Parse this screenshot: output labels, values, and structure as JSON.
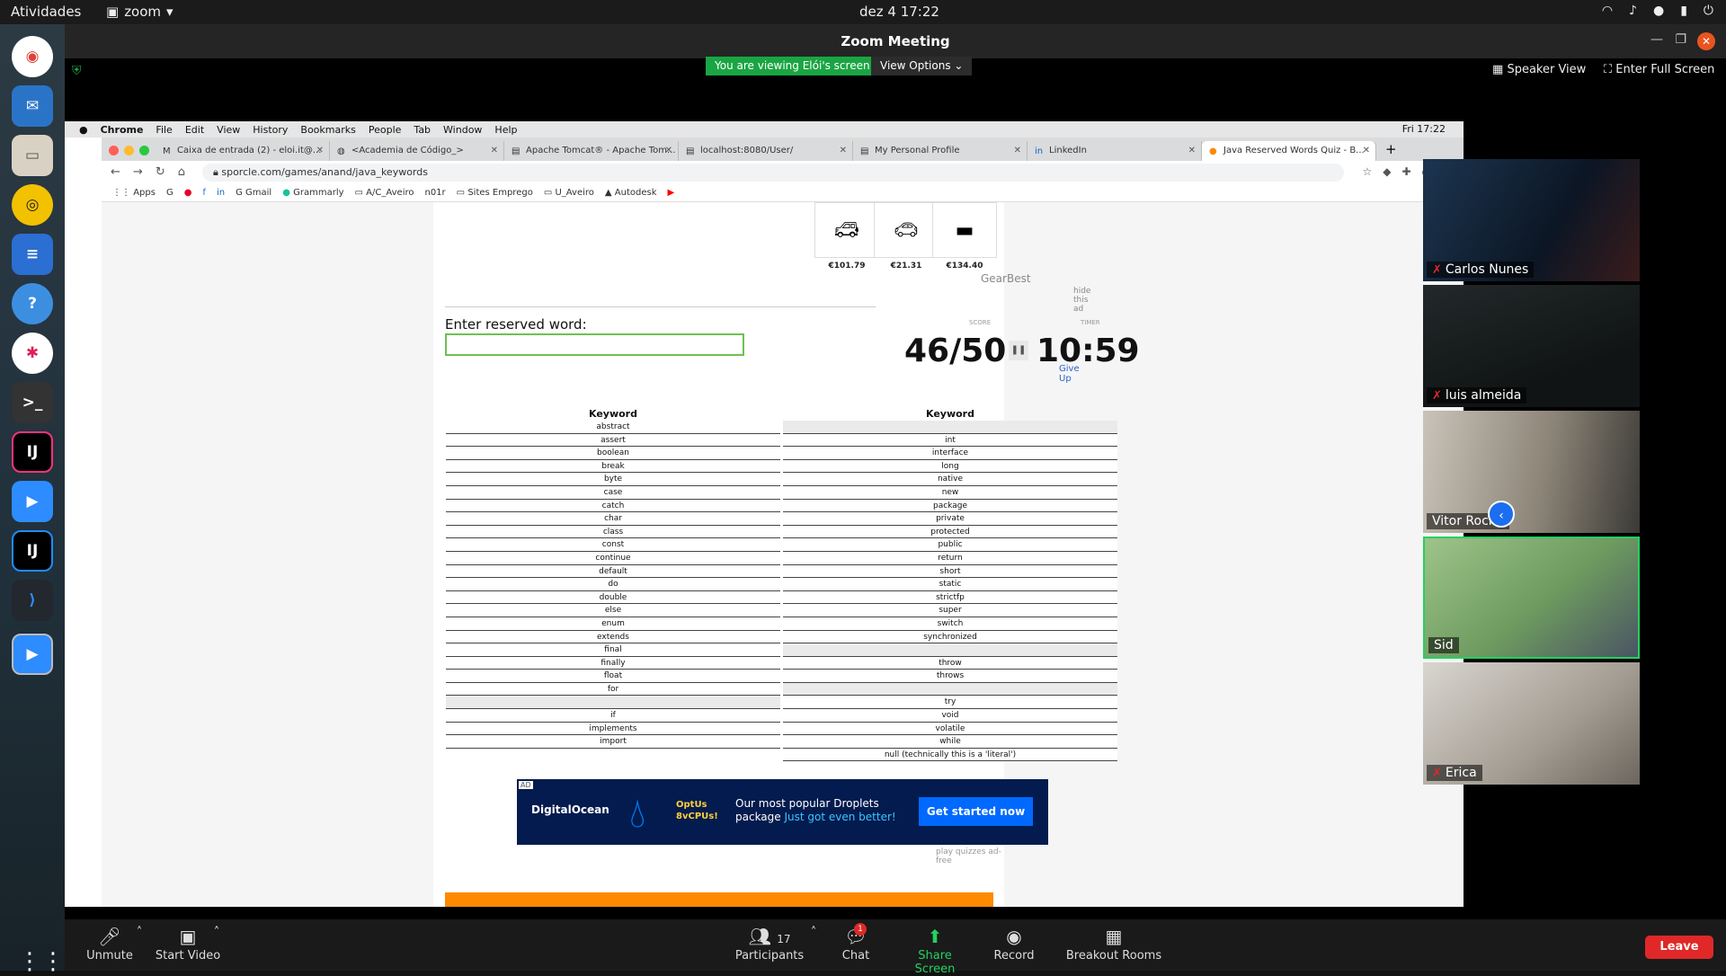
{
  "system": {
    "activities": "Atividades",
    "app_name": "zoom",
    "clock": "dez 4  17:22"
  },
  "zoom": {
    "title": "Zoom Meeting",
    "viewing_banner": "You are viewing Elói's screen",
    "view_options": "View Options",
    "speaker_view": "Speaker View",
    "enter_full_screen": "Enter Full Screen",
    "participants": [
      {
        "name": "Carlos Nunes",
        "muted": true
      },
      {
        "name": "luis almeida",
        "muted": true
      },
      {
        "name": "Vitor Rocha",
        "muted": false
      },
      {
        "name": "Sid",
        "muted": false
      },
      {
        "name": "Erica",
        "muted": true
      }
    ],
    "toolbar": {
      "unmute": "Unmute",
      "start_video": "Start Video",
      "participants_count": "17",
      "participants": "Participants",
      "chat": "Chat",
      "chat_badge": "1",
      "share_screen": "Share Screen",
      "record": "Record",
      "breakout_rooms": "Breakout Rooms",
      "leave": "Leave"
    }
  },
  "mac": {
    "menu": [
      "Chrome",
      "File",
      "Edit",
      "View",
      "History",
      "Bookmarks",
      "People",
      "Tab",
      "Window",
      "Help"
    ],
    "time": "Fri 17:22"
  },
  "chrome": {
    "tabs": [
      {
        "label": "Caixa de entrada (2) - eloi.it@..."
      },
      {
        "label": "<Academia de Código_>"
      },
      {
        "label": "Apache Tomcat® - Apache Tom..."
      },
      {
        "label": "localhost:8080/User/"
      },
      {
        "label": "My Personal Profile"
      },
      {
        "label": "LinkedIn"
      },
      {
        "label": "Java Reserved Words Quiz - B..."
      }
    ],
    "url": "sporcle.com/games/anand/java_keywords",
    "bookmarks": [
      "Apps",
      "Gmail",
      "Grammarly",
      "A/C_Aveiro",
      "n01r",
      "Sites Emprego",
      "U_Aveiro",
      "Autodesk"
    ]
  },
  "quiz": {
    "ad_prices": [
      "€101.79",
      "€21.31",
      "€134.40"
    ],
    "ad_brand": "GearBest",
    "hide_ad": "hide this ad",
    "enter_label": "Enter reserved word:",
    "score_label": "SCORE",
    "timer_label": "TIMER",
    "score": "46/50",
    "timer": "10:59",
    "give_up": "Give Up",
    "column_header": "Keyword",
    "left_keywords": [
      "abstract",
      "assert",
      "boolean",
      "break",
      "byte",
      "case",
      "catch",
      "char",
      "class",
      "const",
      "continue",
      "default",
      "do",
      "double",
      "else",
      "enum",
      "extends",
      "final",
      "finally",
      "float",
      "for",
      "",
      "if",
      "implements",
      "import"
    ],
    "right_keywords": [
      "",
      "int",
      "interface",
      "long",
      "native",
      "new",
      "package",
      "private",
      "protected",
      "public",
      "return",
      "short",
      "static",
      "strictfp",
      "super",
      "switch",
      "synchronized",
      "",
      "throw",
      "throws",
      "",
      "try",
      "void",
      "volatile",
      "while",
      "null (technically this is a 'literal')"
    ],
    "do_ad": {
      "brand": "DigitalOcean",
      "badge_line1": "OptUs",
      "badge_line2": "8vCPUs!",
      "msg_part1": "Our most popular Droplets package ",
      "msg_highlight": "Just got even better!",
      "cta": "Get started now",
      "tag": "AD"
    },
    "ad_free": "play quizzes ad-free"
  }
}
